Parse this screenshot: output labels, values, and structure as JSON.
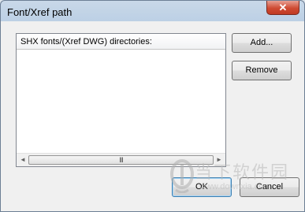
{
  "window": {
    "title": "Font/Xref path",
    "close_label": "✕"
  },
  "list": {
    "header": "SHX fonts/(Xref DWG) directories:",
    "scroll_left": "◄",
    "scroll_right": "►",
    "scroll_grip": "III"
  },
  "buttons": {
    "add": "Add...",
    "remove": "Remove",
    "ok": "OK",
    "cancel": "Cancel"
  },
  "watermark": {
    "text": "当下软件园",
    "url": "www.downxia.com"
  },
  "colors": {
    "titlebar": "#bcd0e5",
    "close": "#cf4b33",
    "face": "#f0f0f0"
  },
  "icons": [
    "close-icon",
    "arrow-left-icon",
    "arrow-right-icon",
    "watermark-logo-icon"
  ]
}
